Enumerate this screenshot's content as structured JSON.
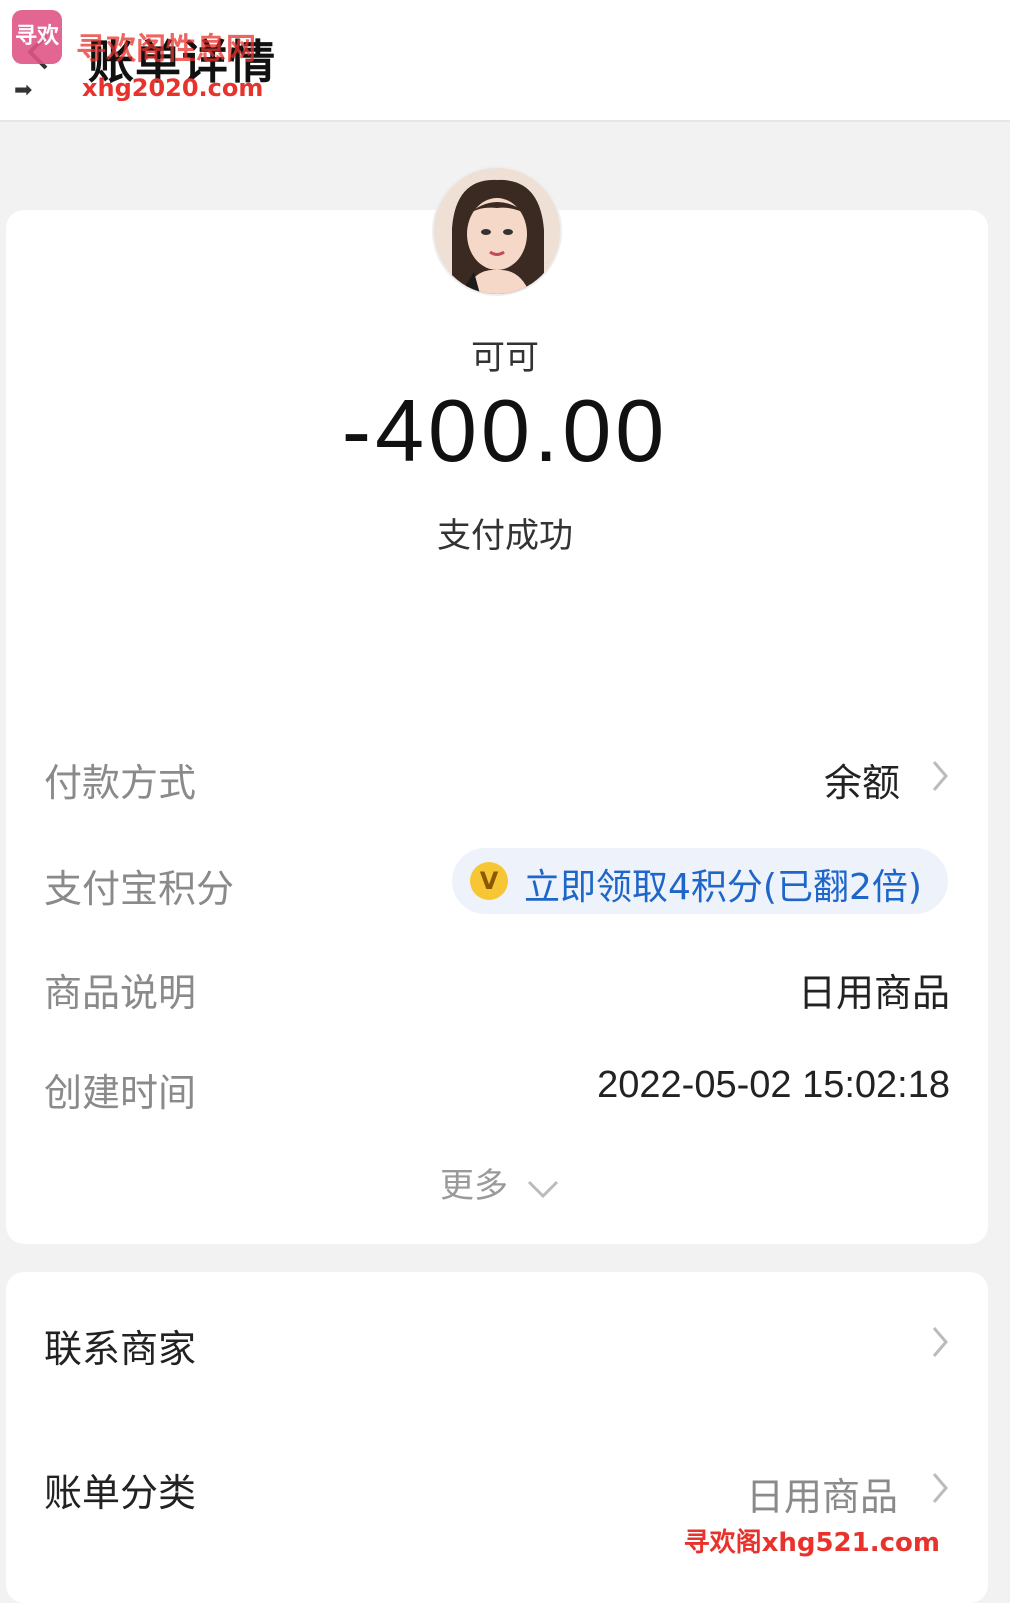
{
  "header": {
    "title": "账单详情",
    "back_icon": "chevron-left-icon"
  },
  "watermark_top": {
    "logo_text": "寻欢",
    "text": "寻欢阁性息网",
    "url": "xhg2020.com"
  },
  "bill": {
    "merchant_name": "可可",
    "amount": "-400.00",
    "status": "支付成功"
  },
  "details": {
    "payment_method_label": "付款方式",
    "payment_method_value": "余额",
    "points_label": "支付宝积分",
    "points_value": "立即领取4积分(已翻2倍)",
    "points_coin": "V",
    "product_label": "商品说明",
    "product_value": "日用商品",
    "created_label": "创建时间",
    "created_value": "2022-05-02 15:02:18",
    "more_label": "更多"
  },
  "actions": {
    "contact_label": "联系商家",
    "category_label": "账单分类",
    "category_value": "日用商品"
  },
  "watermark_bottom": {
    "text": "寻欢阁xhg521.com"
  },
  "colors": {
    "accent_blue": "#1f66c9",
    "watermark_red": "#e8322c",
    "coin_yellow": "#f7c634"
  }
}
